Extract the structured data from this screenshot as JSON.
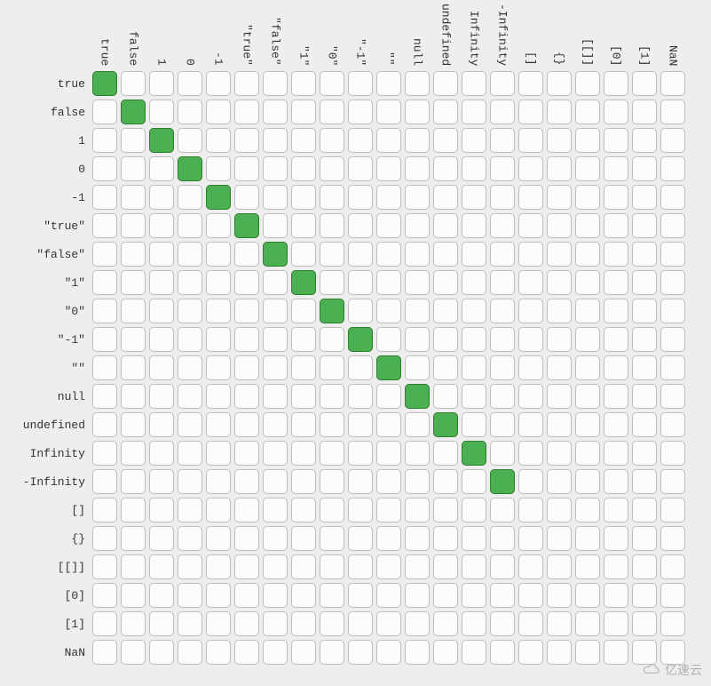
{
  "chart_data": {
    "type": "heatmap",
    "title": "",
    "xlabel": "",
    "ylabel": "",
    "categories": [
      "true",
      "false",
      "1",
      "0",
      "-1",
      "\"true\"",
      "\"false\"",
      "\"1\"",
      "\"0\"",
      "\"-1\"",
      "\"\"",
      "null",
      "undefined",
      "Infinity",
      "-Infinity",
      "[]",
      "{}",
      "[[]]",
      "[0]",
      "[1]",
      "NaN"
    ],
    "rows": [
      "true",
      "false",
      "1",
      "0",
      "-1",
      "\"true\"",
      "\"false\"",
      "\"1\"",
      "\"0\"",
      "\"-1\"",
      "\"\"",
      "null",
      "undefined",
      "Infinity",
      "-Infinity",
      "[]",
      "{}",
      "[[]]",
      "[0]",
      "[1]",
      "NaN"
    ],
    "matrix": [
      [
        1,
        0,
        0,
        0,
        0,
        0,
        0,
        0,
        0,
        0,
        0,
        0,
        0,
        0,
        0,
        0,
        0,
        0,
        0,
        0,
        0
      ],
      [
        0,
        1,
        0,
        0,
        0,
        0,
        0,
        0,
        0,
        0,
        0,
        0,
        0,
        0,
        0,
        0,
        0,
        0,
        0,
        0,
        0
      ],
      [
        0,
        0,
        1,
        0,
        0,
        0,
        0,
        0,
        0,
        0,
        0,
        0,
        0,
        0,
        0,
        0,
        0,
        0,
        0,
        0,
        0
      ],
      [
        0,
        0,
        0,
        1,
        0,
        0,
        0,
        0,
        0,
        0,
        0,
        0,
        0,
        0,
        0,
        0,
        0,
        0,
        0,
        0,
        0
      ],
      [
        0,
        0,
        0,
        0,
        1,
        0,
        0,
        0,
        0,
        0,
        0,
        0,
        0,
        0,
        0,
        0,
        0,
        0,
        0,
        0,
        0
      ],
      [
        0,
        0,
        0,
        0,
        0,
        1,
        0,
        0,
        0,
        0,
        0,
        0,
        0,
        0,
        0,
        0,
        0,
        0,
        0,
        0,
        0
      ],
      [
        0,
        0,
        0,
        0,
        0,
        0,
        1,
        0,
        0,
        0,
        0,
        0,
        0,
        0,
        0,
        0,
        0,
        0,
        0,
        0,
        0
      ],
      [
        0,
        0,
        0,
        0,
        0,
        0,
        0,
        1,
        0,
        0,
        0,
        0,
        0,
        0,
        0,
        0,
        0,
        0,
        0,
        0,
        0
      ],
      [
        0,
        0,
        0,
        0,
        0,
        0,
        0,
        0,
        1,
        0,
        0,
        0,
        0,
        0,
        0,
        0,
        0,
        0,
        0,
        0,
        0
      ],
      [
        0,
        0,
        0,
        0,
        0,
        0,
        0,
        0,
        0,
        1,
        0,
        0,
        0,
        0,
        0,
        0,
        0,
        0,
        0,
        0,
        0
      ],
      [
        0,
        0,
        0,
        0,
        0,
        0,
        0,
        0,
        0,
        0,
        1,
        0,
        0,
        0,
        0,
        0,
        0,
        0,
        0,
        0,
        0
      ],
      [
        0,
        0,
        0,
        0,
        0,
        0,
        0,
        0,
        0,
        0,
        0,
        1,
        0,
        0,
        0,
        0,
        0,
        0,
        0,
        0,
        0
      ],
      [
        0,
        0,
        0,
        0,
        0,
        0,
        0,
        0,
        0,
        0,
        0,
        0,
        1,
        0,
        0,
        0,
        0,
        0,
        0,
        0,
        0
      ],
      [
        0,
        0,
        0,
        0,
        0,
        0,
        0,
        0,
        0,
        0,
        0,
        0,
        0,
        1,
        0,
        0,
        0,
        0,
        0,
        0,
        0
      ],
      [
        0,
        0,
        0,
        0,
        0,
        0,
        0,
        0,
        0,
        0,
        0,
        0,
        0,
        0,
        1,
        0,
        0,
        0,
        0,
        0,
        0
      ],
      [
        0,
        0,
        0,
        0,
        0,
        0,
        0,
        0,
        0,
        0,
        0,
        0,
        0,
        0,
        0,
        0,
        0,
        0,
        0,
        0,
        0
      ],
      [
        0,
        0,
        0,
        0,
        0,
        0,
        0,
        0,
        0,
        0,
        0,
        0,
        0,
        0,
        0,
        0,
        0,
        0,
        0,
        0,
        0
      ],
      [
        0,
        0,
        0,
        0,
        0,
        0,
        0,
        0,
        0,
        0,
        0,
        0,
        0,
        0,
        0,
        0,
        0,
        0,
        0,
        0,
        0
      ],
      [
        0,
        0,
        0,
        0,
        0,
        0,
        0,
        0,
        0,
        0,
        0,
        0,
        0,
        0,
        0,
        0,
        0,
        0,
        0,
        0,
        0
      ],
      [
        0,
        0,
        0,
        0,
        0,
        0,
        0,
        0,
        0,
        0,
        0,
        0,
        0,
        0,
        0,
        0,
        0,
        0,
        0,
        0,
        0
      ],
      [
        0,
        0,
        0,
        0,
        0,
        0,
        0,
        0,
        0,
        0,
        0,
        0,
        0,
        0,
        0,
        0,
        0,
        0,
        0,
        0,
        0
      ]
    ],
    "legend": {
      "0": "false/empty",
      "1": "true/green"
    }
  },
  "colors": {
    "on": "#4caf50",
    "on_border": "#2e7d32",
    "off": "#fcfcfc",
    "off_border": "#bfbfbf",
    "bg": "#eeeeee"
  },
  "watermark": {
    "site": "亿速云",
    "url": ""
  }
}
